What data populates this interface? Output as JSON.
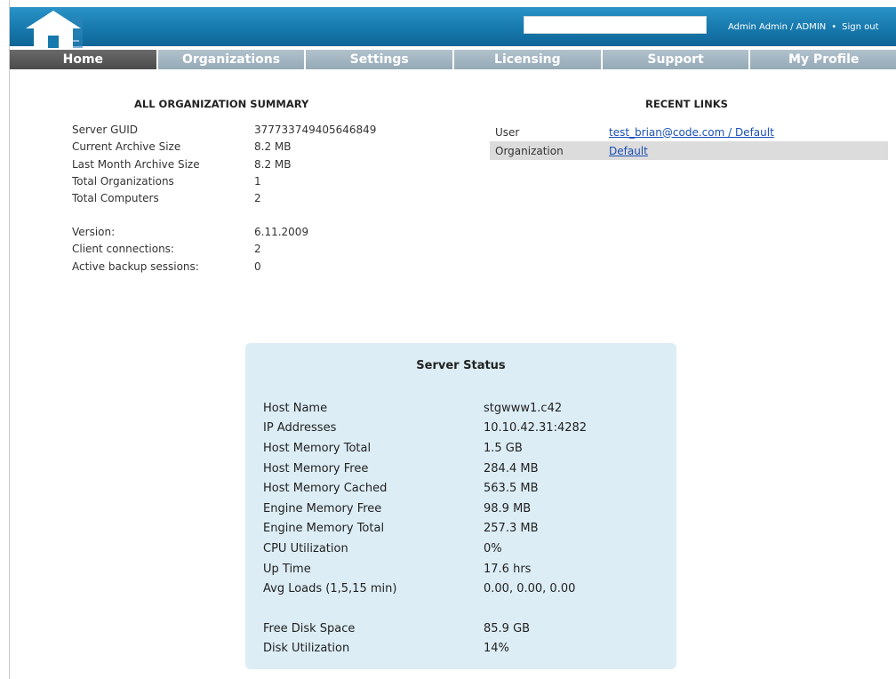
{
  "header": {
    "search": {
      "value": "",
      "placeholder": ""
    },
    "user_label": "Admin Admin / ADMIN",
    "separator": "•",
    "signout_label": "Sign out",
    "logo_icon": "house-icon"
  },
  "nav": {
    "tabs": [
      {
        "label": "Home",
        "active": true
      },
      {
        "label": "Organizations",
        "active": false
      },
      {
        "label": "Settings",
        "active": false
      },
      {
        "label": "Licensing",
        "active": false
      },
      {
        "label": "Support",
        "active": false
      },
      {
        "label": "My Profile",
        "active": false
      }
    ]
  },
  "summary": {
    "title": "ALL ORGANIZATION SUMMARY",
    "rows": [
      {
        "label": "Server GUID",
        "value": "377733749405646849"
      },
      {
        "label": "Current Archive Size",
        "value": "8.2 MB"
      },
      {
        "label": "Last Month Archive Size",
        "value": "8.2 MB"
      },
      {
        "label": "Total Organizations",
        "value": "1"
      },
      {
        "label": "Total Computers",
        "value": "2"
      }
    ],
    "rows2": [
      {
        "label": "Version:",
        "value": "6.11.2009"
      },
      {
        "label": "Client connections:",
        "value": "2"
      },
      {
        "label": "Active backup sessions:",
        "value": "0"
      }
    ]
  },
  "recent_links": {
    "title": "RECENT LINKS",
    "rows": [
      {
        "label": "User",
        "link": "test_brian@code.com / Default"
      },
      {
        "label": "Organization",
        "link": "Default"
      }
    ]
  },
  "server_status": {
    "title": "Server Status",
    "rows": [
      {
        "label": "Host Name",
        "value": "stgwww1.c42"
      },
      {
        "label": "IP Addresses",
        "value": "10.10.42.31:4282"
      },
      {
        "label": "Host Memory Total",
        "value": "1.5 GB"
      },
      {
        "label": "Host Memory Free",
        "value": "284.4 MB"
      },
      {
        "label": "Host Memory Cached",
        "value": "563.5 MB"
      },
      {
        "label": "Engine Memory Free",
        "value": "98.9 MB"
      },
      {
        "label": "Engine Memory Total",
        "value": "257.3 MB"
      },
      {
        "label": "CPU Utilization",
        "value": "0%"
      },
      {
        "label": "Up Time",
        "value": "17.6 hrs"
      },
      {
        "label": "Avg Loads (1,5,15 min)",
        "value": "0.00, 0.00, 0.00"
      }
    ],
    "rows2": [
      {
        "label": "Free Disk Space",
        "value": "85.9 GB"
      },
      {
        "label": "Disk Utilization",
        "value": "14%"
      }
    ]
  },
  "colors": {
    "header_blue": "#1779ad",
    "tab_inactive": "#a3b6c2",
    "tab_active": "#555555",
    "status_box": "#dcedf5",
    "link": "#1a4fb5"
  }
}
